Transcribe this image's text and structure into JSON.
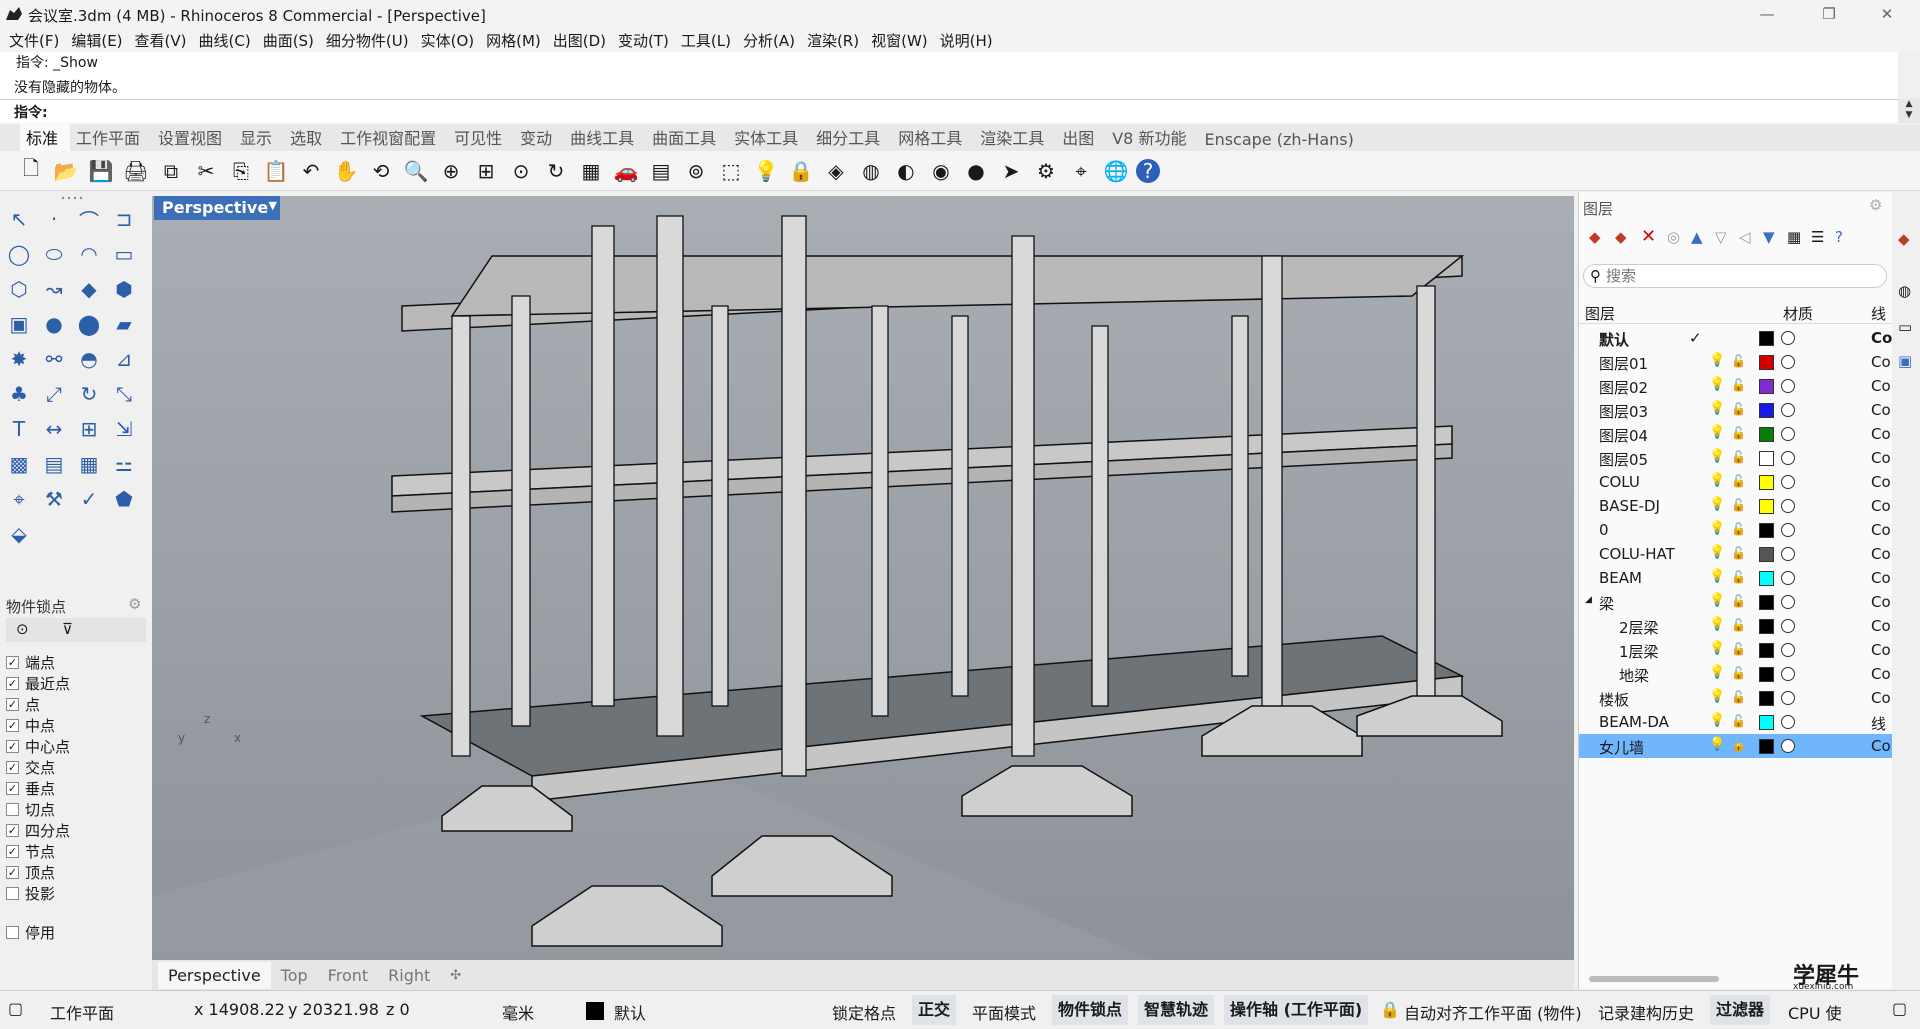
{
  "window": {
    "title": "会议室.3dm (4 MB) - Rhinoceros 8 Commercial - [Perspective]",
    "min": "—",
    "max": "❐",
    "close": "✕"
  },
  "menu": [
    "文件(F)",
    "编辑(E)",
    "查看(V)",
    "曲线(C)",
    "曲面(S)",
    "细分物件(U)",
    "实体(O)",
    "网格(M)",
    "出图(D)",
    "变动(T)",
    "工具(L)",
    "分析(A)",
    "渲染(R)",
    "视窗(W)",
    "说明(H)"
  ],
  "command": {
    "history1": "指令: _Show",
    "history2": "没有隐藏的物体。",
    "prompt": "指令:"
  },
  "tabs": [
    "标准",
    "工作平面",
    "设置视图",
    "显示",
    "选取",
    "工作视窗配置",
    "可见性",
    "变动",
    "曲线工具",
    "曲面工具",
    "实体工具",
    "细分工具",
    "网格工具",
    "渲染工具",
    "出图",
    "V8 新功能",
    "Enscape (zh-Hans)"
  ],
  "toolbar_icons": [
    "new-icon",
    "open-icon",
    "save-icon",
    "print-icon",
    "import-icon",
    "cut-icon",
    "copy-icon",
    "paste-icon",
    "undo-icon",
    "pan-icon",
    "rotate-view-icon",
    "zoom-icon",
    "zoom-window-icon",
    "zoom-extents-icon",
    "zoom-selected-icon",
    "rotate-icon",
    "four-view-icon",
    "car-icon",
    "grid-plane-icon",
    "osnap-icon",
    "select-icon",
    "light-icon",
    "lock-icon",
    "layer-icon",
    "color-wheel-icon",
    "material-icon",
    "render-sphere-icon",
    "render-icon",
    "arrow-icon",
    "settings-icon",
    "dimension-icon",
    "globe-icon",
    "help-icon"
  ],
  "osnap": {
    "title": "物件锁点",
    "items": [
      {
        "label": "端点",
        "checked": true
      },
      {
        "label": "最近点",
        "checked": true
      },
      {
        "label": "点",
        "checked": true
      },
      {
        "label": "中点",
        "checked": true
      },
      {
        "label": "中心点",
        "checked": true
      },
      {
        "label": "交点",
        "checked": true
      },
      {
        "label": "垂点",
        "checked": true
      },
      {
        "label": "切点",
        "checked": false
      },
      {
        "label": "四分点",
        "checked": true
      },
      {
        "label": "节点",
        "checked": true
      },
      {
        "label": "顶点",
        "checked": true
      },
      {
        "label": "投影",
        "checked": false
      }
    ],
    "disable": {
      "label": "停用",
      "checked": false
    }
  },
  "viewport": {
    "title": "Perspective",
    "tabs": [
      "Perspective",
      "Top",
      "Front",
      "Right"
    ],
    "axis_z": "z",
    "axis_x": "x",
    "axis_y": "y"
  },
  "layers": {
    "title": "图层",
    "search_placeholder": "搜索",
    "col_name": "图层",
    "col_material": "材质",
    "col_line": "线",
    "rows": [
      {
        "name": "默认",
        "indent": 0,
        "color": "#000000",
        "current": true,
        "co": "Co"
      },
      {
        "name": "图层01",
        "indent": 0,
        "color": "#d40000",
        "co": "Co"
      },
      {
        "name": "图层02",
        "indent": 0,
        "color": "#7f2ccf",
        "co": "Co"
      },
      {
        "name": "图层03",
        "indent": 0,
        "color": "#1a1ae6",
        "co": "Co"
      },
      {
        "name": "图层04",
        "indent": 0,
        "color": "#0a7a0a",
        "co": "Co"
      },
      {
        "name": "图层05",
        "indent": 0,
        "color": "#ffffff",
        "co": "Co"
      },
      {
        "name": "COLU",
        "indent": 0,
        "color": "#ffff00",
        "co": "Co"
      },
      {
        "name": "BASE-DJ",
        "indent": 0,
        "color": "#ffff00",
        "co": "Co"
      },
      {
        "name": "0",
        "indent": 0,
        "color": "#000000",
        "co": "Co"
      },
      {
        "name": "COLU-HAT",
        "indent": 0,
        "color": "#555555",
        "co": "Co"
      },
      {
        "name": "BEAM",
        "indent": 0,
        "color": "#00ffff",
        "co": "Co"
      },
      {
        "name": "梁",
        "indent": 0,
        "color": "#000000",
        "co": "Co",
        "expand": "◢"
      },
      {
        "name": "2层梁",
        "indent": 1,
        "color": "#000000",
        "co": "Co"
      },
      {
        "name": "1层梁",
        "indent": 1,
        "color": "#000000",
        "co": "Co"
      },
      {
        "name": "地梁",
        "indent": 1,
        "color": "#000000",
        "co": "Co"
      },
      {
        "name": "楼板",
        "indent": 0,
        "color": "#000000",
        "co": "Co"
      },
      {
        "name": "BEAM-DA",
        "indent": 0,
        "color": "#00ffff",
        "co": "线"
      },
      {
        "name": "女儿墙",
        "indent": 0,
        "color": "#000000",
        "co": "Co",
        "selected": true
      }
    ]
  },
  "status": {
    "workplane": "工作平面",
    "x": "x 14908.22",
    "y": "y 20321.98",
    "z": "z 0",
    "unit": "毫米",
    "layer": "默认",
    "grid_snap": "锁定格点",
    "ortho": "正交",
    "planar": "平面模式",
    "osnap": "物件锁点",
    "smarttrack": "智慧轨迹",
    "gumball": "操作轴 (工作平面)",
    "autoalign": "自动对齐工作平面 (物件)",
    "history": "记录建构历史",
    "filter": "过滤器",
    "cpu": "CPU 使"
  },
  "watermark": {
    "big": "学犀牛",
    "small": "xuexiniu.com"
  }
}
